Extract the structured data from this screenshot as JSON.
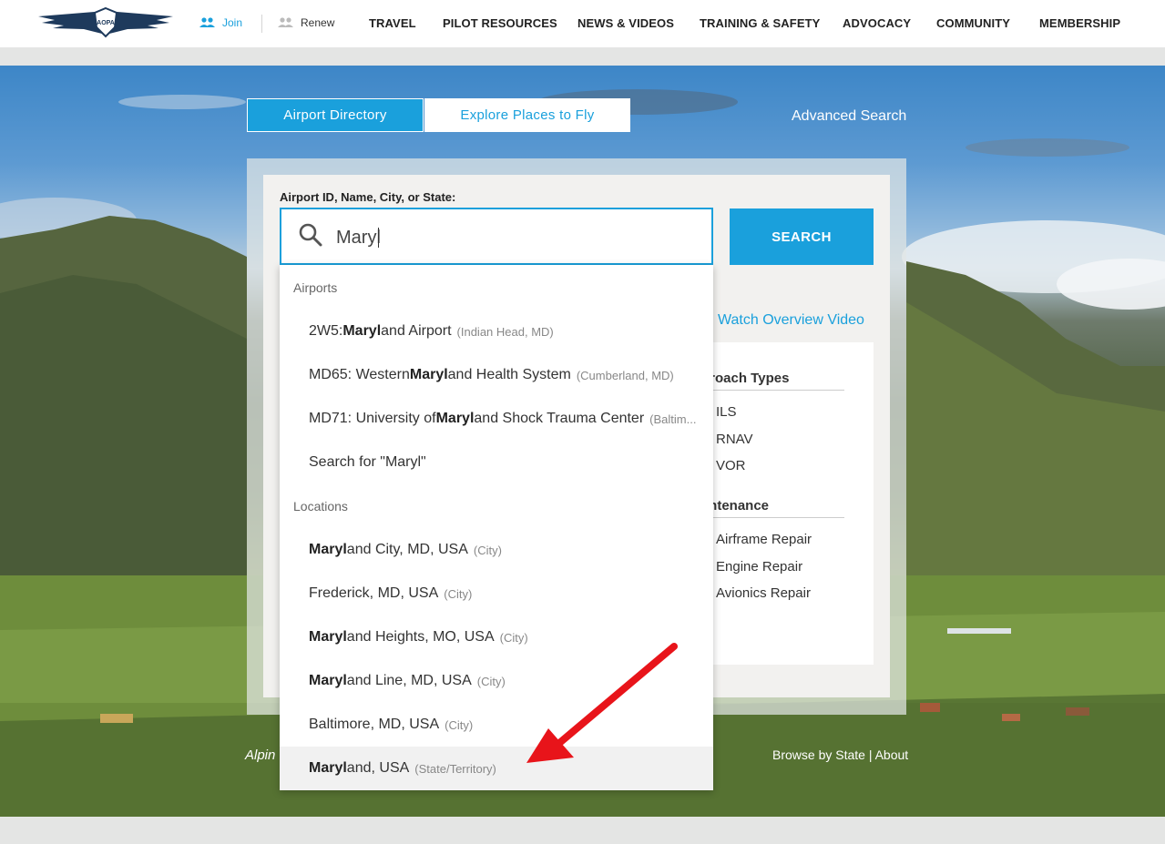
{
  "header": {
    "join_label": "Join",
    "renew_label": "Renew",
    "nav": [
      {
        "label": "TRAVEL"
      },
      {
        "label": "PILOT RESOURCES"
      },
      {
        "label": "NEWS & VIDEOS"
      },
      {
        "label": "TRAINING & SAFETY"
      },
      {
        "label": "ADVOCACY"
      },
      {
        "label": "COMMUNITY"
      },
      {
        "label": "MEMBERSHIP"
      }
    ],
    "logo_text": "AOPA"
  },
  "tabs": {
    "active": "Airport Directory",
    "inactive": "Explore Places to Fly",
    "advanced": "Advanced Search"
  },
  "search": {
    "label": "Airport ID, Name, City, or State:",
    "value": "Maryl",
    "button": "SEARCH"
  },
  "overview_link": "Watch Overview Video",
  "filters": {
    "approach_title": "proach Types",
    "approach_items": [
      "ILS",
      "RNAV",
      "VOR"
    ],
    "maintenance_title": "intenance",
    "maintenance_items": [
      "Airframe Repair",
      "Engine Repair",
      "Avionics Repair"
    ]
  },
  "dropdown": {
    "airports_heading": "Airports",
    "airports": [
      {
        "pre": "2W5: ",
        "match": "Maryl",
        "post": "and Airport",
        "meta": "(Indian Head, MD)"
      },
      {
        "pre": "MD65: Western ",
        "match": "Maryl",
        "post": "and Health System",
        "meta": "(Cumberland, MD)"
      },
      {
        "pre": "MD71: University of ",
        "match": "Maryl",
        "post": "and Shock Trauma Center",
        "meta": "(Baltim..."
      }
    ],
    "search_for": "Search for \"Maryl\"",
    "locations_heading": "Locations",
    "locations": [
      {
        "pre": "",
        "match": "Maryl",
        "post": "and City, MD, USA",
        "meta": "(City)"
      },
      {
        "pre": "Frederick, MD, USA",
        "match": "",
        "post": "",
        "meta": "(City)"
      },
      {
        "pre": "",
        "match": "Maryl",
        "post": "and Heights, MO, USA",
        "meta": "(City)"
      },
      {
        "pre": "",
        "match": "Maryl",
        "post": "and Line, MD, USA",
        "meta": "(City)"
      },
      {
        "pre": "Baltimore, MD, USA",
        "match": "",
        "post": "",
        "meta": "(City)"
      },
      {
        "pre": "",
        "match": "Maryl",
        "post": "and, USA",
        "meta": "(State/Territory)"
      }
    ]
  },
  "footer_links": {
    "browse": "Browse by State",
    "sep": "|",
    "about": "About",
    "caption": "Alpin"
  },
  "colors": {
    "accent": "#1aa0dc",
    "arrow": "#e8141a"
  }
}
